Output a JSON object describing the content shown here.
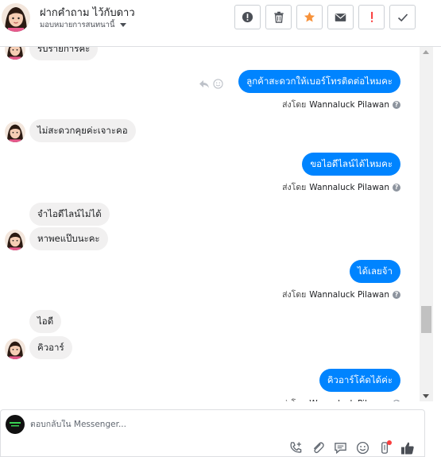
{
  "header": {
    "contact_name": "ฝากคำถาม ไว้กับดาว",
    "assign_label": "มอบหมายการสนทนานี้",
    "tools": [
      {
        "icon": "alert-circle-icon"
      },
      {
        "icon": "trash-icon"
      },
      {
        "icon": "star-icon"
      },
      {
        "icon": "mail-icon"
      },
      {
        "icon": "exclamation-icon"
      },
      {
        "icon": "check-icon"
      }
    ]
  },
  "thread": {
    "sent_by_prefix": "ส่งโดย",
    "agent_name": "Wannaluck Pilawan",
    "messages": [
      {
        "dir": "in",
        "text": "รับรายการค่ะ"
      },
      {
        "dir": "out",
        "text": "ลูกค้าสะดวกให้เบอร์โทรติดต่อไหมคะ"
      },
      {
        "dir": "in",
        "text": "ไม่สะดวกคุยค่ะเจาะคอ"
      },
      {
        "dir": "out",
        "text": "ขอไอดีไลน์ได้ไหมคะ"
      },
      {
        "dir": "in",
        "text": "จำไอดีไลน์ไม่ได้"
      },
      {
        "dir": "in",
        "text": "หาพeแป๊บนะคะ"
      },
      {
        "dir": "out",
        "text": "ได้เลยจ้า"
      },
      {
        "dir": "in",
        "text": "ไอดี"
      },
      {
        "dir": "in",
        "text": "คิวอาร์"
      },
      {
        "dir": "out",
        "text": "คิวอาร์โค้ดได้ค่ะ"
      }
    ]
  },
  "composer": {
    "placeholder": "ตอบกลับใน Messenger...",
    "tools": [
      "add-call-icon",
      "attachment-icon",
      "saved-reply-icon",
      "emoji-icon",
      "sticker-icon",
      "thumbs-up-icon"
    ]
  },
  "colors": {
    "accent": "#0084ff",
    "incoming_bubble": "#f1f0f0",
    "star": "#f7923b",
    "alert": "#fa3e3e"
  }
}
